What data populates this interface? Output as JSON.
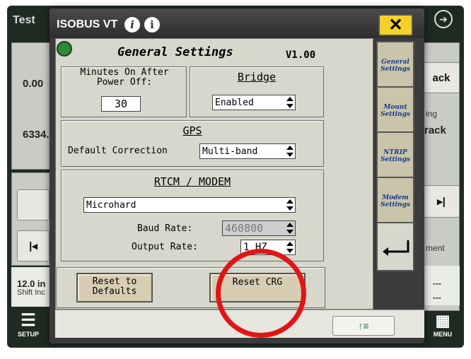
{
  "background": {
    "top_left_title": "Test",
    "left_values": [
      "0.00",
      "6334."
    ],
    "right_labels": [
      "ack",
      "ing",
      "rack",
      "ment"
    ],
    "bottom_left_value": "12.0 in",
    "bottom_left_label": "Shift Inc",
    "right_dashes": [
      "---",
      "---"
    ],
    "setup_label": "SETUP",
    "menu_label": "MENU"
  },
  "dialog": {
    "title": "ISOBUS VT",
    "close_label": "✕"
  },
  "screen": {
    "title": "General Settings",
    "version": "V1.00",
    "minutes_label": "Minutes On After Power Off:",
    "minutes_value": "30",
    "bridge_label": "Bridge",
    "bridge_value": "Enabled",
    "gps_label": "GPS",
    "default_correction_label": "Default Correction",
    "default_correction_value": "Multi-band",
    "rtcm_label": "RTCM / MODEM",
    "modem_value": "Microhard",
    "baud_rate_label": "Baud Rate:",
    "baud_rate_value": "460800",
    "output_rate_label": "Output Rate:",
    "output_rate_value": "1 HZ",
    "reset_defaults_label": "Reset to Defaults",
    "reset_crg_label": "Reset CRG"
  },
  "softkeys": [
    {
      "label": "General Settings"
    },
    {
      "label": "Mount Settings"
    },
    {
      "label": "NTRIP Settings"
    },
    {
      "label": "Modem Settings"
    }
  ],
  "nav": {
    "label": "↑≡"
  },
  "colors": {
    "highlight": "#e01616",
    "close": "#f4d02a",
    "accent_green": "#1e7b3a"
  }
}
